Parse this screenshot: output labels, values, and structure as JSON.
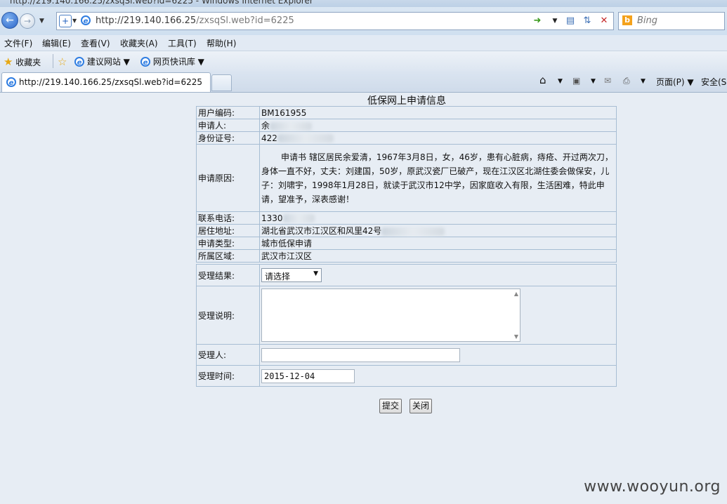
{
  "window": {
    "title": "http://219.140.166.25/zxsqSl.web?id=6225 - Windows Internet Explorer"
  },
  "address": {
    "url_host": "http://219.140.166.25",
    "url_path": "/zxsqSl.web?id=6225",
    "search_placeholder": "Bing"
  },
  "menu": [
    {
      "label": "文件(F)"
    },
    {
      "label": "编辑(E)"
    },
    {
      "label": "查看(V)"
    },
    {
      "label": "收藏夹(A)"
    },
    {
      "label": "工具(T)"
    },
    {
      "label": "帮助(H)"
    }
  ],
  "favorites": {
    "label": "收藏夹",
    "items": [
      {
        "label": "建议网站 ▼"
      },
      {
        "label": "网页快讯库 ▼"
      }
    ]
  },
  "tab": {
    "title": "http://219.140.166.25/zxsqSl.web?id=6225"
  },
  "commandbar": {
    "page": "页面(P) ▼",
    "safety": "安全(S"
  },
  "form": {
    "title": "低保网上申请信息",
    "rows": {
      "user_code": {
        "label": "用户编码:",
        "value": "BM161955"
      },
      "applicant": {
        "label": "申请人:",
        "value": "余"
      },
      "id_number": {
        "label": "身份证号:",
        "value": "422"
      },
      "reason": {
        "label": "申请原因:",
        "value": "申请书 辖区居民余爱清，1967年3月8日，女，46岁，患有心脏病，痔疮、开过两次刀，身体一直不好，丈夫：刘建国，50岁，原武汉瓷厂已破产，现在江汉区北湖住委会做保安，儿子：刘啸宇，1998年1月28日，就读于武汉市12中学，因家庭收入有限，生活困难，特此申请，望准予，深表感谢！"
      },
      "phone": {
        "label": "联系电话:",
        "value": "1330"
      },
      "address": {
        "label": "居住地址:",
        "value": "湖北省武汉市江汉区和风里42号"
      },
      "apply_type": {
        "label": "申请类型:",
        "value": "城市低保申请"
      },
      "region": {
        "label": "所属区域:",
        "value": "武汉市江汉区"
      }
    },
    "process": {
      "result": {
        "label": "受理结果:",
        "selected": "请选择"
      },
      "note": {
        "label": "受理说明:"
      },
      "handler": {
        "label": "受理人:"
      },
      "time": {
        "label": "受理时间:",
        "value": "2015-12-04"
      }
    },
    "buttons": {
      "submit": "提交",
      "close": "关闭"
    }
  },
  "watermark": "www.wooyun.org"
}
